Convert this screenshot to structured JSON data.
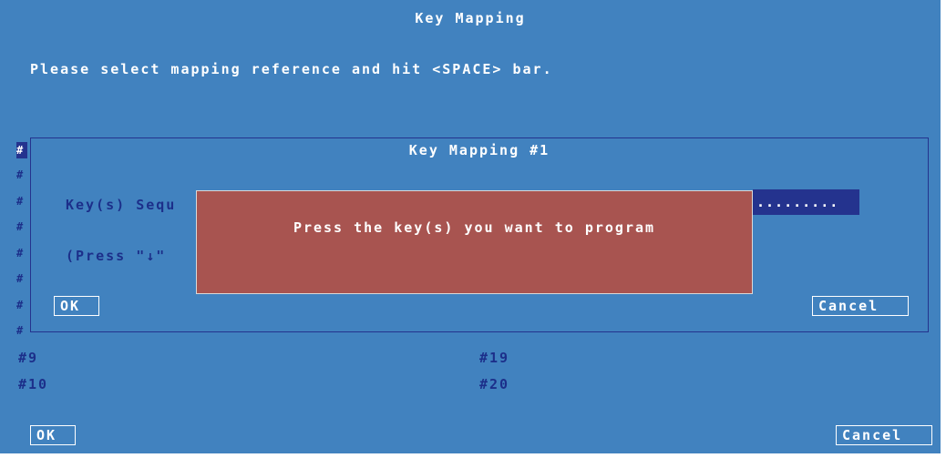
{
  "main": {
    "title": "Key Mapping",
    "instruction": "Please select mapping reference and hit <SPACE> bar.",
    "list_left": [
      "#9",
      "#10"
    ],
    "list_right": [
      "#19",
      "#20"
    ],
    "ok_label": "OK",
    "cancel_label": "Cancel"
  },
  "dialog": {
    "title": "Key Mapping #1",
    "sequence_label": "Key(s) Sequ",
    "sequence_value": ".........",
    "press_hint": "(Press \"↓\"",
    "ok_label": "OK",
    "cancel_label": "Cancel"
  },
  "popup": {
    "message": "Press the key(s) you want to program"
  },
  "list_markers": [
    "#",
    "#",
    "#",
    "#",
    "#",
    "#",
    "#",
    "#"
  ],
  "colors": {
    "background": "#4182bf",
    "dark_text": "#1c2f8a",
    "selection": "#24338e",
    "popup": "#a85450"
  }
}
